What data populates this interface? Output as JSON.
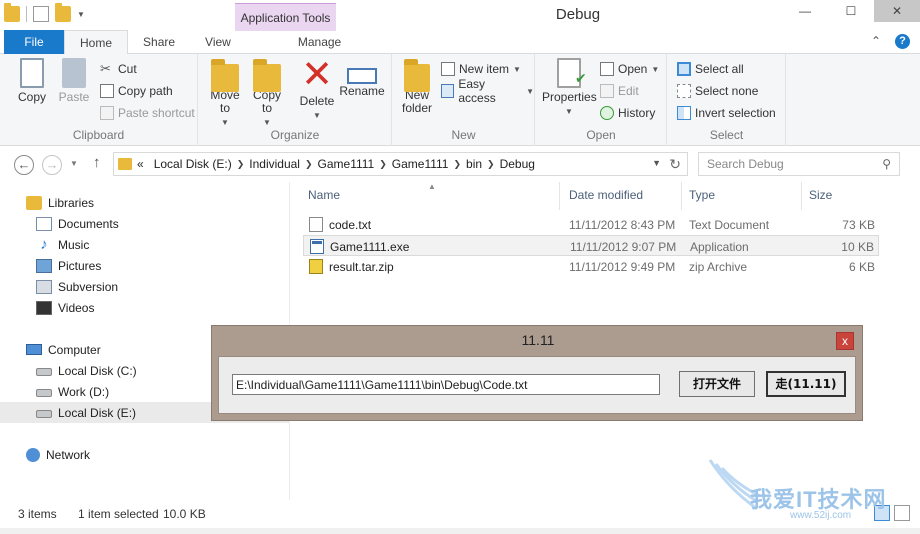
{
  "window": {
    "title": "Debug",
    "app_tools_label": "Application Tools",
    "minimize": "—",
    "maximize": "☐",
    "close": "✕"
  },
  "ribbon_tabs": [
    "File",
    "Home",
    "Share",
    "View",
    "Manage"
  ],
  "ribbon": {
    "clipboard": {
      "label": "Clipboard",
      "copy": "Copy",
      "paste": "Paste",
      "cut": "Cut",
      "copy_path": "Copy path",
      "paste_shortcut": "Paste shortcut"
    },
    "organize": {
      "label": "Organize",
      "move_to": "Move to",
      "copy_to": "Copy to",
      "delete": "Delete",
      "rename": "Rename"
    },
    "new": {
      "label": "New",
      "new_folder": "New folder",
      "new_item": "New item",
      "easy_access": "Easy access"
    },
    "open": {
      "label": "Open",
      "properties": "Properties",
      "open": "Open",
      "edit": "Edit",
      "history": "History"
    },
    "select": {
      "label": "Select",
      "select_all": "Select all",
      "select_none": "Select none",
      "invert_selection": "Invert selection"
    }
  },
  "address": {
    "breadcrumbs": [
      "Local Disk (E:)",
      "Individual",
      "Game1111",
      "Game1111",
      "bin",
      "Debug"
    ],
    "overflow": "«",
    "search_placeholder": "Search Debug"
  },
  "nav_pane": {
    "libraries": "Libraries",
    "library_items": [
      "Documents",
      "Music",
      "Pictures",
      "Subversion",
      "Videos"
    ],
    "computer": "Computer",
    "drives": [
      "Local Disk (C:)",
      "Work (D:)",
      "Local Disk (E:)"
    ],
    "network": "Network"
  },
  "columns": {
    "name": "Name",
    "date": "Date modified",
    "type": "Type",
    "size": "Size"
  },
  "files": [
    {
      "name": "code.txt",
      "date": "11/11/2012 8:43 PM",
      "type": "Text Document",
      "size": "73 KB"
    },
    {
      "name": "Game1111.exe",
      "date": "11/11/2012 9:07 PM",
      "type": "Application",
      "size": "10 KB"
    },
    {
      "name": "result.tar.zip",
      "date": "11/11/2012 9:49 PM",
      "type": "zip Archive",
      "size": "6 KB"
    }
  ],
  "status": {
    "items": "3 items",
    "selected": "1 item selected",
    "size": "10.0 KB"
  },
  "dialog": {
    "title": "11.11",
    "path_value": "E:\\Individual\\Game1111\\Game1111\\bin\\Debug\\Code.txt",
    "open_file_label": "打开文件",
    "go_label": "走(11.11)",
    "close": "x"
  },
  "watermark": {
    "title": "我爱IT技术网",
    "url": "www.52ij.com"
  }
}
